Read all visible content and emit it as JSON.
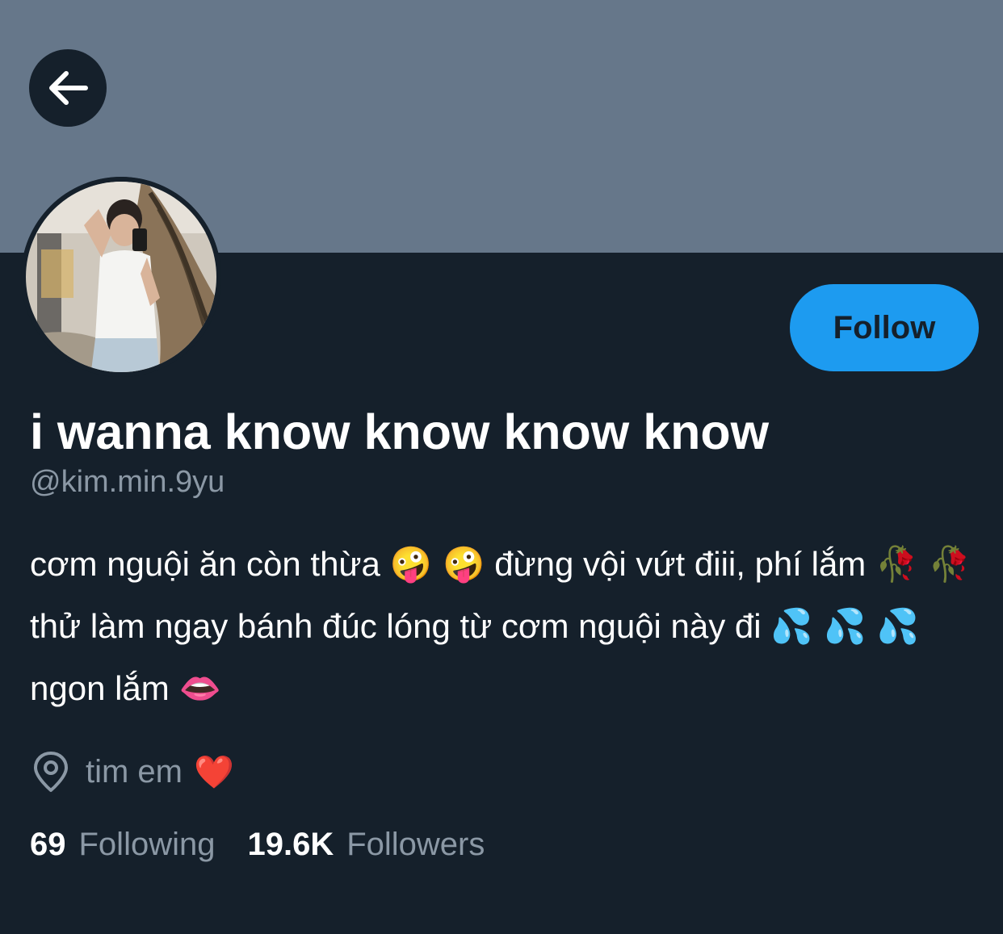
{
  "banner": {
    "color": "#66778a"
  },
  "back_button": {
    "icon": "arrow-left-icon"
  },
  "profile": {
    "avatar_icon": "profile-photo",
    "follow_label": "Follow",
    "display_name": "i wanna know know know know",
    "handle": "@kim.min.9yu",
    "bio": {
      "part1": "cơm nguội ăn còn thừa ",
      "emoji1": "🤪 🤪",
      "part2": "  đừng vội vứt điii, phí lắm ",
      "emoji2": "🥀 🥀",
      "part3": "  thử làm ngay bánh đúc lóng từ cơm nguội này đi ",
      "emoji3": "💦 💦 💦",
      "part4": "  ngon lắm ",
      "emoji4": "👄"
    },
    "location": {
      "icon": "location-pin-icon",
      "text": "tim em",
      "emoji": "❤️"
    },
    "stats": {
      "following_count": "69",
      "following_label": "Following",
      "followers_count": "19.6K",
      "followers_label": "Followers"
    }
  },
  "colors": {
    "background": "#15202b",
    "accent": "#1d9bf0",
    "secondary_text": "#8b98a5",
    "primary_text": "#ffffff"
  }
}
